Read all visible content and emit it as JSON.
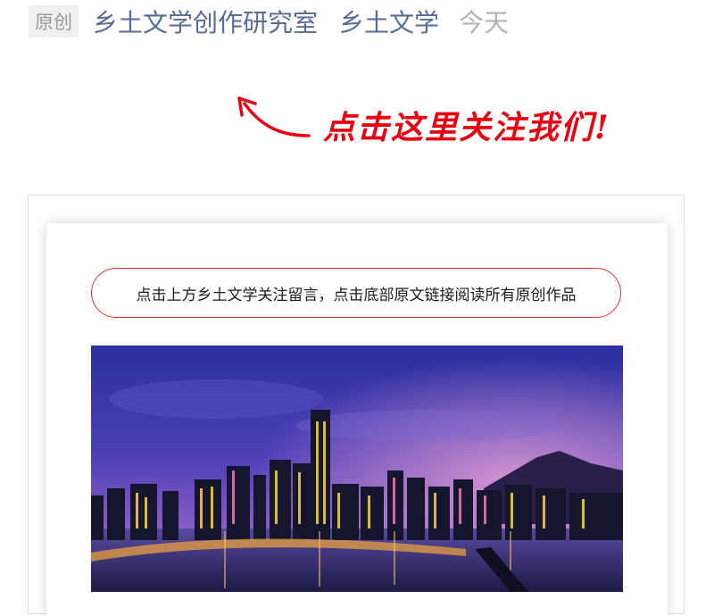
{
  "header": {
    "badge": "原创",
    "author": "乡土文学创作研究室",
    "account": "乡土文学",
    "date": "今天"
  },
  "banner": {
    "follow_text": "点击这里关注我们!"
  },
  "card": {
    "notice": "点击上方乡土文学关注留言，点击底部原文链接阅读所有原创作品"
  },
  "colors": {
    "link_blue": "#576b95",
    "accent_red": "#e60012",
    "frame_border": "#cfe6e6"
  }
}
